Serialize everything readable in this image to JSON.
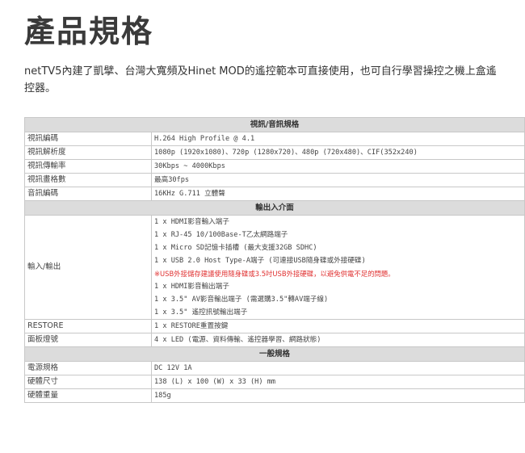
{
  "page": {
    "title": "產品規格",
    "intro": "netTV5內建了凱擘、台灣大寬頻及Hinet MOD的遙控範本可直接使用，也可自行學習操控之機上盒遙控器。"
  },
  "spec": {
    "av_header": "視訊/音訊規格",
    "av_rows": [
      {
        "label": "視訊編碼",
        "value": "H.264 High Profile @ 4.1"
      },
      {
        "label": "視訊解析度",
        "value": "1080p (1920x1080)、720p (1280x720)、480p (720x480)、CIF(352x240)"
      },
      {
        "label": "視訊傳輸率",
        "value": "30Kbps ~ 4000Kbps"
      },
      {
        "label": "視訊畫格數",
        "value": "最高30fps"
      },
      {
        "label": "音訊編碼",
        "value": "16KHz G.711 立體聲"
      }
    ],
    "io_header": "輸出入介面",
    "io_label": "輸入/輸出",
    "io_lines": [
      "1 x HDMI影音輸入端子",
      "1 x RJ-45 10/100Base-T乙太網路端子",
      "1 x Micro SD記憶卡插槽 (最大支援32GB SDHC)",
      "1 x USB 2.0 Host Type-A端子 (可連接USB隨身碟或外接硬碟)",
      "※USB外接儲存建議使用隨身碟或3.5吋USB外接硬碟，以避免供電不足的問題。",
      "1 x HDMI影音輸出端子",
      "1 x 3.5\" AV影音輸出端子 (需選購3.5\"轉AV端子線)",
      "1 x 3.5\" 遙控訊號輸出端子"
    ],
    "io_rows": [
      {
        "label": "RESTORE",
        "value": "1 x RESTORE重置按鍵"
      },
      {
        "label": "面板燈號",
        "value": "4 x LED (電源、資料傳輸、遙控器學習、網路狀態)"
      }
    ],
    "gen_header": "一般規格",
    "gen_rows": [
      {
        "label": "電源規格",
        "value": "DC 12V 1A"
      },
      {
        "label": "硬體尺寸",
        "value": "138 (L)  x 100 (W)  x 33 (H)  mm"
      },
      {
        "label": "硬體重量",
        "value": "185g"
      }
    ],
    "note_color": "#e03030"
  }
}
